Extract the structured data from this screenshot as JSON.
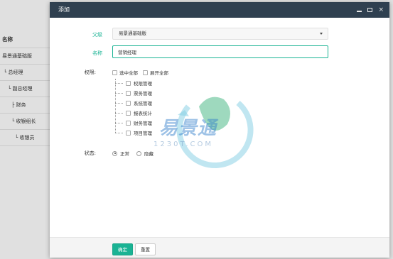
{
  "background": {
    "header": "名称",
    "rows": [
      {
        "label": "易景通基础版",
        "indent": 3
      },
      {
        "label": "└ 总经理",
        "indent": 5
      },
      {
        "label": "└ 副总经理",
        "indent": 11
      },
      {
        "label": "├ 财务",
        "indent": 16
      },
      {
        "label": "└ 收银组长",
        "indent": 16
      },
      {
        "label": "└ 收银员",
        "indent": 21
      }
    ]
  },
  "dialog": {
    "title": "添加",
    "controls": {
      "minimize": "minimize",
      "maximize": "maximize",
      "close": "×"
    }
  },
  "form": {
    "parent": {
      "label": "父级",
      "value": "易景通基础版"
    },
    "name": {
      "label": "名称",
      "value": "营销经理"
    },
    "permissions": {
      "label": "权限:",
      "select_all": "选中全部",
      "expand_all": "展开全部",
      "items": [
        {
          "label": "权限管理",
          "checked": false
        },
        {
          "label": "票务管理",
          "checked": false
        },
        {
          "label": "系统管理",
          "checked": false
        },
        {
          "label": "报表统计",
          "checked": false
        },
        {
          "label": "财务管理",
          "checked": false
        },
        {
          "label": "项目管理",
          "checked": false
        }
      ]
    },
    "status": {
      "label": "状态:",
      "options": [
        {
          "label": "正常",
          "selected": true
        },
        {
          "label": "隐藏",
          "selected": false
        }
      ]
    }
  },
  "footer": {
    "confirm": "确定",
    "reset": "重置"
  },
  "watermark": {
    "text": "易景通",
    "domain": "1230T.COM"
  },
  "colors": {
    "titlebar": "#2f4050",
    "accent": "#1ab394"
  }
}
